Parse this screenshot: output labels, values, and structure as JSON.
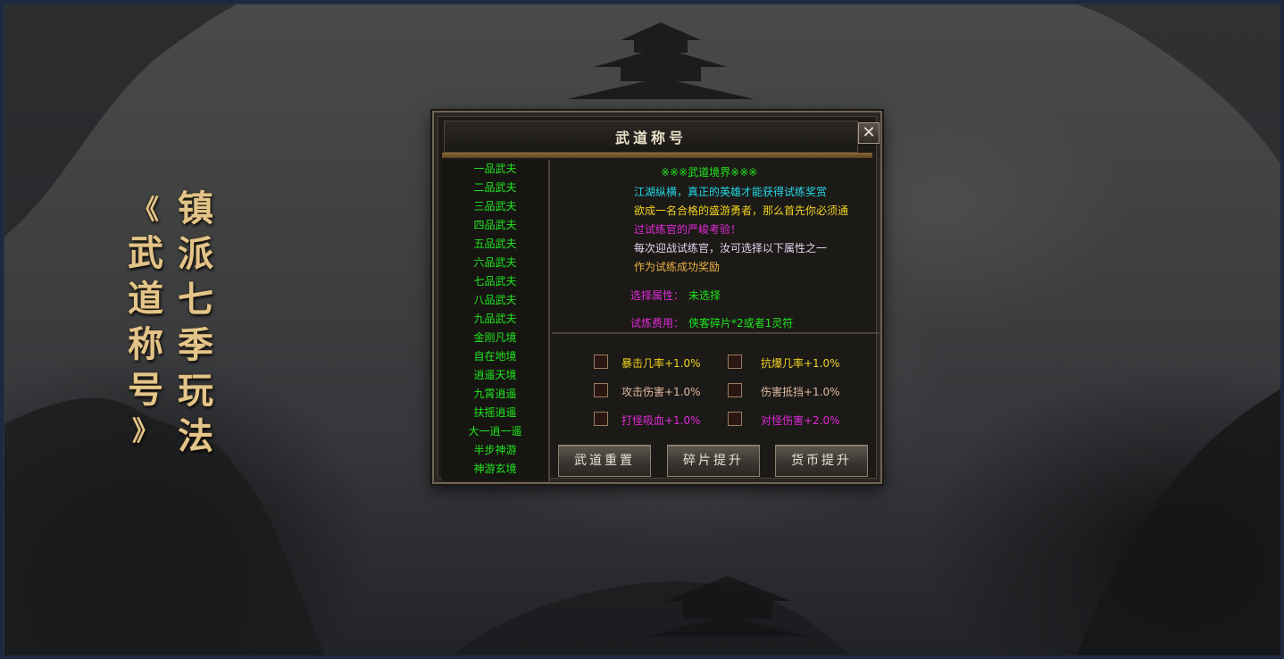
{
  "side_title": {
    "right_column": [
      "镇",
      "派",
      "七",
      "季",
      "玩",
      "法"
    ],
    "left_column": [
      "《",
      "武",
      "道",
      "称",
      "号",
      "》"
    ]
  },
  "dialog": {
    "title": "武道称号",
    "close_label": "✕",
    "realms": [
      "一品武夫",
      "二品武夫",
      "三品武夫",
      "四品武夫",
      "五品武夫",
      "六品武夫",
      "七品武夫",
      "八品武夫",
      "九品武夫",
      "金刚凡境",
      "自在地境",
      "逍遥天境",
      "九霄逍遥",
      "扶摇逍遥",
      "大一逍一遥",
      "半步神游",
      "神游玄境"
    ],
    "info": {
      "header": "※※※武道境界※※※",
      "line1": "江湖纵横，真正的英雄才能获得试练奖赏",
      "line2": "欲成一名合格的盛游勇者，那么首先你必须通",
      "line3": "过试练官的严峻考验！",
      "line4": "每次迎战试练官，汝可选择以下属性之一",
      "line5": "作为试练成功奖励",
      "attr_label": "选择属性：",
      "attr_value": "未选择",
      "cost_label": "试炼费用：",
      "cost_value": "侠客碎片*2或者1灵符"
    },
    "options": [
      {
        "label": "暴击几率+1.0%",
        "color": "#f0d21e"
      },
      {
        "label": "抗爆几率+1.0%",
        "color": "#f0d21e"
      },
      {
        "label": "攻击伤害+1.0%",
        "color": "#e0b8a0"
      },
      {
        "label": "伤害抵挡+1.0%",
        "color": "#e0b8a0"
      },
      {
        "label": "打怪吸血+1.0%",
        "color": "#e12ad8"
      },
      {
        "label": "对怪伤害+2.0%",
        "color": "#e12ad8"
      }
    ],
    "buttons": {
      "reset": "武道重置",
      "fragment": "碎片提升",
      "currency": "货币提升"
    }
  },
  "colors": {
    "realm_text": "#1ee81e",
    "header_green": "#1ee81e",
    "cyan": "#22d8e8",
    "yellow": "#f0d21e",
    "magenta": "#e12ad8",
    "lavender": "#e6d4f0",
    "gold_text": "#e8b042",
    "side_title_gold": "#e3c58a"
  }
}
